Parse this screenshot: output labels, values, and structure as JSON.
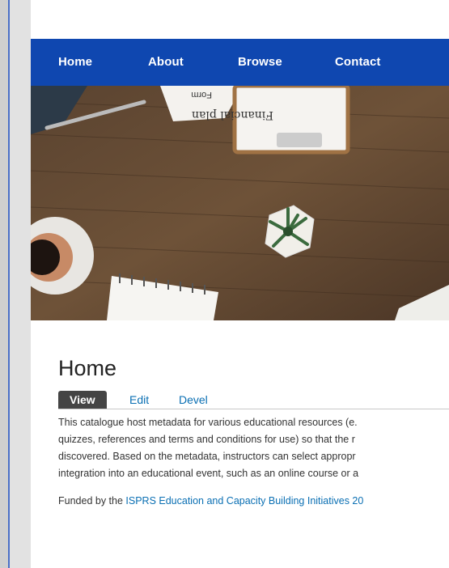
{
  "nav": {
    "items": [
      {
        "label": "Home"
      },
      {
        "label": "About"
      },
      {
        "label": "Browse"
      },
      {
        "label": "Contact"
      }
    ]
  },
  "hero": {
    "clipboard_text": "Financial plan",
    "form_text": "Form"
  },
  "main": {
    "title": "Home",
    "tabs": [
      {
        "label": "View",
        "active": true
      },
      {
        "label": "Edit"
      },
      {
        "label": "Devel"
      }
    ],
    "paragraph_lines": [
      "This catalogue host metadata for various educational resources (e.",
      "quizzes, references and terms and conditions for use) so that the r",
      "discovered. Based on the metadata, instructors can select appropr",
      "integration into an educational event, such as an online course or a"
    ],
    "funded_prefix": "Funded by the ",
    "funded_link": "ISPRS Education and Capacity Building Initiatives 20"
  },
  "colors": {
    "nav_bg": "#0f47b0",
    "link": "#0a6fb3",
    "active_tab_bg": "#444444"
  }
}
